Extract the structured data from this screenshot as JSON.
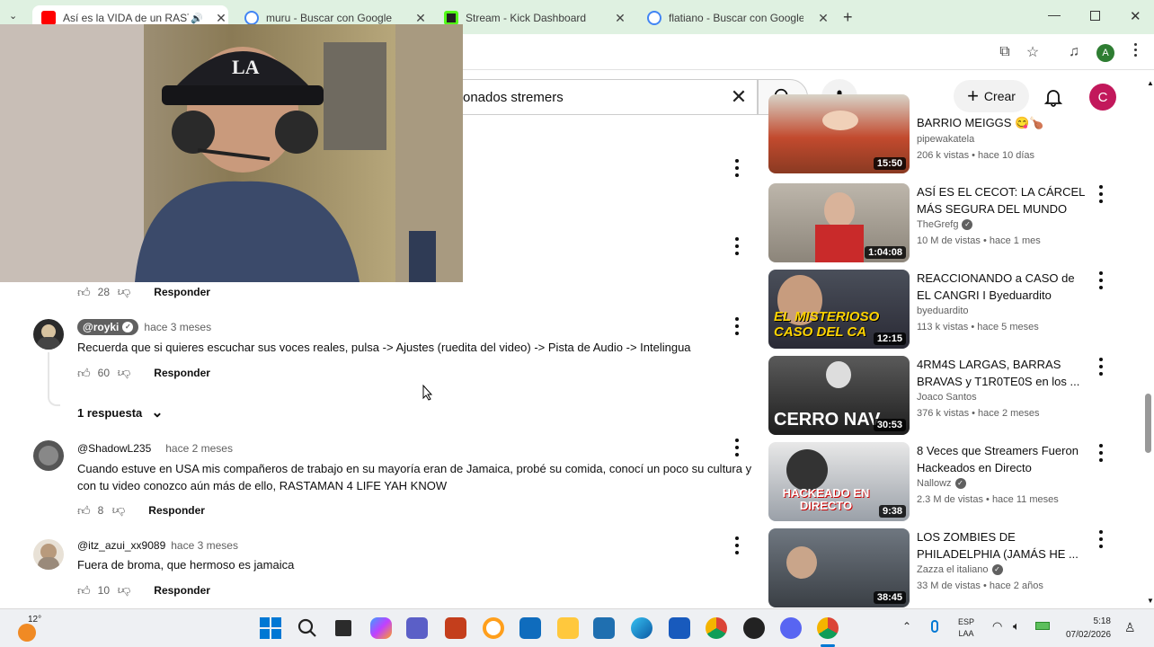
{
  "browser": {
    "tabs": [
      {
        "title": "Así es la VIDA de un RASTAMAN",
        "color": "#ff0000"
      },
      {
        "title": "muru - Buscar con Google",
        "color": "#4285f4"
      },
      {
        "title": "Stream - Kick Dashboard",
        "color": "#53fc18"
      },
      {
        "title": "flatiano - Buscar con Google",
        "color": "#4285f4"
      }
    ],
    "profile_initial": "A"
  },
  "header": {
    "search_value": "onados stremers",
    "create_label": "Crear",
    "avatar_initial": "C"
  },
  "comments": [
    {
      "likes": "28",
      "reply_label": "Responder"
    },
    {
      "author": "@royki",
      "time": "hace 3 meses",
      "text": "Recuerda que si quieres escuchar sus voces reales, pulsa -> Ajustes (ruedita del video) -> Pista de Audio -> Intelingua",
      "likes": "60",
      "reply_label": "Responder",
      "replies_label": "1 respuesta"
    },
    {
      "author": "@ShadowL235",
      "time": "hace 2 meses",
      "text": "Cuando estuve en USA mis compañeros de trabajo en su mayoría eran de Jamaica, probé su comida, conocí un poco su cultura y con tu video conozco aún más de ello, RASTAMAN 4 LIFE YAH KNOW",
      "likes": "8",
      "reply_label": "Responder"
    },
    {
      "author": "@itz_azui_xx9089",
      "time": "hace 3 meses",
      "text": "Fuera de broma, que hermoso es jamaica",
      "likes": "10",
      "reply_label": "Responder"
    }
  ],
  "related": [
    {
      "title": "BARRIO MEIGGS 😋🍗",
      "channel": "pipewakatela",
      "verified": false,
      "meta": "206 k vistas • hace 10 días",
      "duration": "15:50",
      "thumb_text": ""
    },
    {
      "title": "ASÍ ES EL CECOT: LA CÁRCEL MÁS SEGURA DEL MUNDO",
      "channel": "TheGrefg",
      "verified": true,
      "meta": "10 M de vistas • hace 1 mes",
      "duration": "1:04:08",
      "thumb_text": ""
    },
    {
      "title": "REACCIONANDO a CASO de EL CANGRI I Byeduardito",
      "channel": "byeduardito",
      "verified": false,
      "meta": "113 k vistas • hace 5 meses",
      "duration": "12:15",
      "thumb_text": "EL MISTERIOSO CASO DEL CA"
    },
    {
      "title": "4RM4S LARGAS, BARRAS BRAVAS y T1R0TE0S en los ...",
      "channel": "Joaco Santos",
      "verified": false,
      "meta": "376 k vistas • hace 2 meses",
      "duration": "30:53",
      "thumb_text": "CERRO NAV"
    },
    {
      "title": "8 Veces que Streamers Fueron Hackeados en Directo",
      "channel": "Nallowz",
      "verified": true,
      "meta": "2.3 M de vistas • hace 11 meses",
      "duration": "9:38",
      "thumb_text": "HACKEADO EN DIRECTO"
    },
    {
      "title": "LOS ZOMBIES DE PHILADELPHIA (JAMÁS HE ...",
      "channel": "Zazza el italiano",
      "verified": true,
      "meta": "33 M de vistas • hace 2 años",
      "duration": "38:45",
      "thumb_text": ""
    }
  ],
  "taskbar": {
    "weather": "12°",
    "lang_top": "ESP",
    "lang_bottom": "LAA",
    "time": "5:18",
    "date": "07/02/2026"
  }
}
